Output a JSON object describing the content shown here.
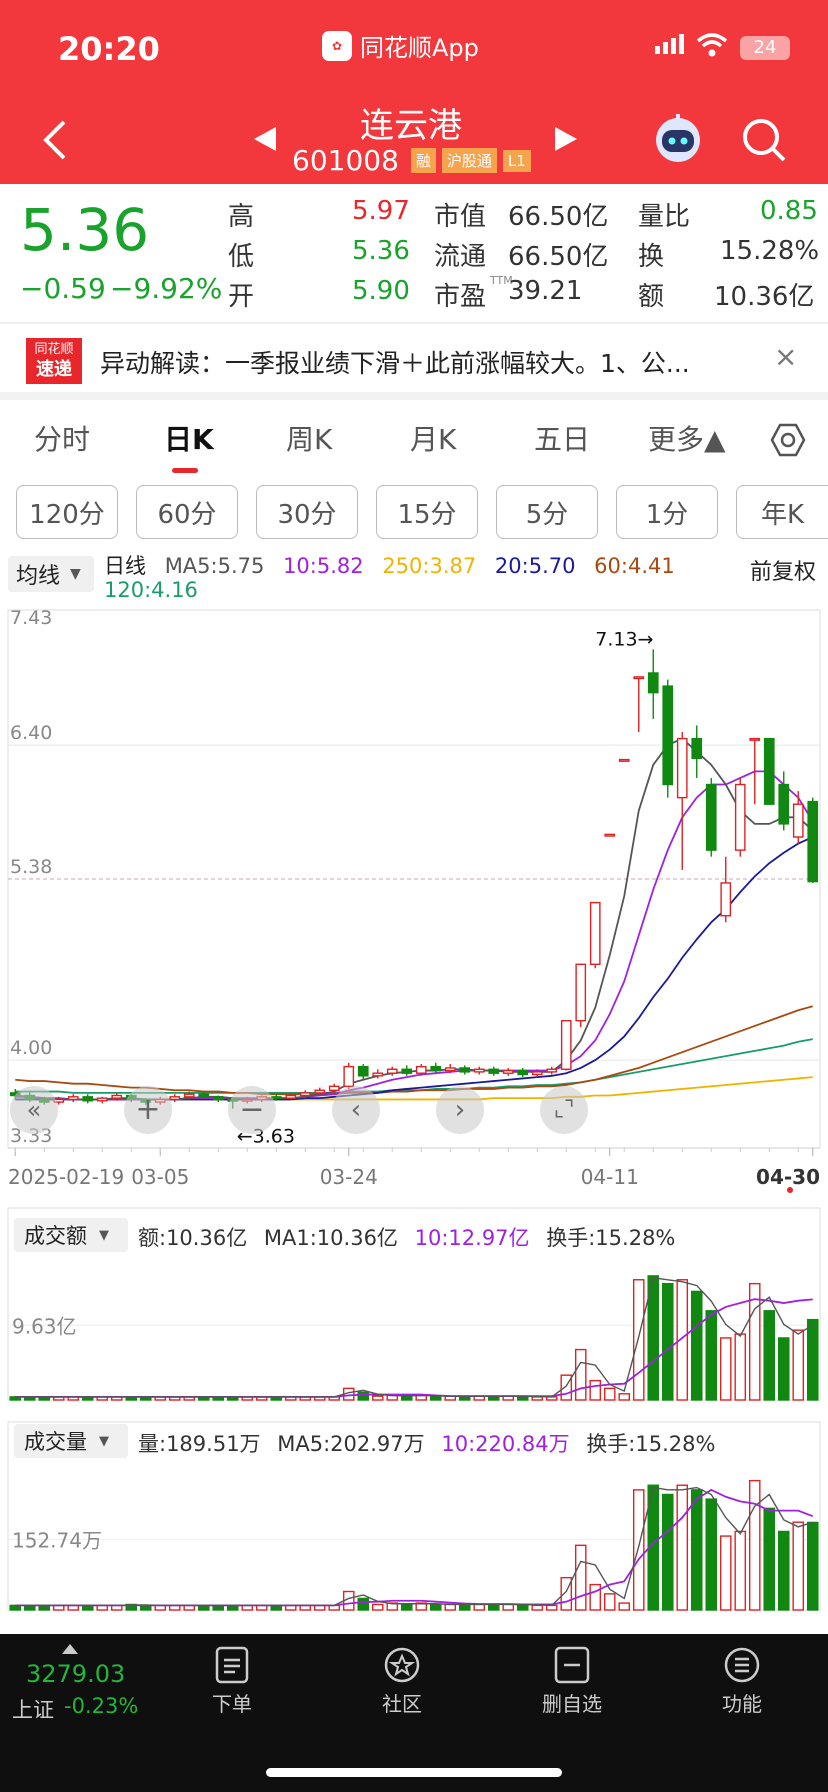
{
  "status": {
    "time": "20:20",
    "app": "同花顺App",
    "battery": "24"
  },
  "header": {
    "name": "连云港",
    "code": "601008",
    "badges": [
      "融",
      "沪股通",
      "L1"
    ]
  },
  "quote": {
    "price": "5.36",
    "change": "−0.59",
    "pct": "−9.92%",
    "c1": [
      {
        "k": "高",
        "v": "5.97",
        "c": "red"
      },
      {
        "k": "低",
        "v": "5.36",
        "c": "green"
      },
      {
        "k": "开",
        "v": "5.90",
        "c": "green"
      }
    ],
    "c2": [
      {
        "k": "市值",
        "v": "66.50亿"
      },
      {
        "k": "流通",
        "v": "66.50亿"
      },
      {
        "k": "市盈",
        "v": "39.21",
        "sup": "TTM"
      }
    ],
    "c3": [
      {
        "k": "量比",
        "v": "0.85",
        "c": "green"
      },
      {
        "k": "换",
        "v": "15.28%"
      },
      {
        "k": "额",
        "v": "10.36亿"
      }
    ]
  },
  "news": {
    "logo1": "同花顺",
    "logo2": "速递",
    "text": "异动解读：一季报业绩下滑＋此前涨幅较大。1、公..."
  },
  "tabs": [
    "分时",
    "日K",
    "周K",
    "月K",
    "五日",
    "更多▲"
  ],
  "periods": [
    "120分",
    "60分",
    "30分",
    "15分",
    "5分",
    "1分",
    "年K"
  ],
  "indicator": {
    "sel": "均线",
    "line": "日线",
    "ma5": "MA5:5.75",
    "ma10": "10:5.82",
    "ma250": "250:3.87",
    "ma20": "20:5.70",
    "ma60": "60:4.41",
    "ma120": "120:4.16",
    "fq": "前复权"
  },
  "chart_data": {
    "type": "candlestick",
    "title": "日线",
    "yticks": [
      "7.43",
      "6.40",
      "5.38",
      "4.00",
      "3.33"
    ],
    "xlabels": [
      "2025-02-19",
      "03-05",
      "03-24",
      "04-11",
      "04-30"
    ],
    "high_mark": "7.13→",
    "low_mark": "←3.63",
    "candles": [
      [
        3.75,
        3.73,
        3.78,
        3.7
      ],
      [
        3.73,
        3.7,
        3.76,
        3.68
      ],
      [
        3.7,
        3.68,
        3.72,
        3.66
      ],
      [
        3.68,
        3.7,
        3.72,
        3.66
      ],
      [
        3.7,
        3.72,
        3.74,
        3.68
      ],
      [
        3.72,
        3.69,
        3.74,
        3.67
      ],
      [
        3.69,
        3.71,
        3.72,
        3.67
      ],
      [
        3.71,
        3.73,
        3.75,
        3.69
      ],
      [
        3.73,
        3.7,
        3.74,
        3.68
      ],
      [
        3.7,
        3.68,
        3.71,
        3.66
      ],
      [
        3.68,
        3.7,
        3.72,
        3.66
      ],
      [
        3.7,
        3.72,
        3.74,
        3.68
      ],
      [
        3.72,
        3.74,
        3.76,
        3.7
      ],
      [
        3.74,
        3.72,
        3.76,
        3.7
      ],
      [
        3.72,
        3.7,
        3.73,
        3.68
      ],
      [
        3.7,
        3.69,
        3.71,
        3.63
      ],
      [
        3.69,
        3.7,
        3.72,
        3.67
      ],
      [
        3.7,
        3.72,
        3.73,
        3.68
      ],
      [
        3.72,
        3.71,
        3.74,
        3.69
      ],
      [
        3.71,
        3.73,
        3.75,
        3.7
      ],
      [
        3.73,
        3.75,
        3.77,
        3.71
      ],
      [
        3.75,
        3.77,
        3.79,
        3.73
      ],
      [
        3.77,
        3.8,
        3.82,
        3.75
      ],
      [
        3.8,
        3.95,
        3.98,
        3.78
      ],
      [
        3.95,
        3.88,
        3.97,
        3.85
      ],
      [
        3.88,
        3.9,
        3.93,
        3.86
      ],
      [
        3.9,
        3.93,
        3.95,
        3.88
      ],
      [
        3.93,
        3.9,
        3.96,
        3.88
      ],
      [
        3.9,
        3.95,
        3.97,
        3.88
      ],
      [
        3.95,
        3.92,
        3.98,
        3.9
      ],
      [
        3.92,
        3.94,
        3.97,
        3.9
      ],
      [
        3.94,
        3.91,
        3.96,
        3.89
      ],
      [
        3.91,
        3.93,
        3.95,
        3.89
      ],
      [
        3.93,
        3.9,
        3.95,
        3.88
      ],
      [
        3.9,
        3.92,
        3.94,
        3.88
      ],
      [
        3.92,
        3.89,
        3.94,
        3.87
      ],
      [
        3.89,
        3.91,
        3.93,
        3.87
      ],
      [
        3.91,
        3.93,
        3.95,
        3.89
      ],
      [
        3.93,
        4.3,
        4.3,
        3.92
      ],
      [
        4.3,
        4.73,
        4.73,
        4.25
      ],
      [
        4.73,
        5.2,
        5.2,
        4.7
      ],
      [
        5.72,
        5.72,
        5.72,
        5.72
      ],
      [
        6.29,
        6.29,
        6.29,
        6.29
      ],
      [
        6.92,
        6.92,
        6.92,
        6.5
      ],
      [
        6.95,
        6.8,
        7.13,
        6.6
      ],
      [
        6.85,
        6.1,
        6.9,
        6.0
      ],
      [
        6.0,
        6.45,
        6.5,
        5.45
      ],
      [
        6.45,
        6.3,
        6.55,
        6.15
      ],
      [
        6.1,
        5.6,
        6.15,
        5.55
      ],
      [
        5.1,
        5.35,
        5.55,
        5.05
      ],
      [
        5.6,
        6.1,
        6.15,
        5.55
      ],
      [
        6.45,
        6.45,
        6.45,
        5.95
      ],
      [
        6.45,
        5.95,
        6.45,
        5.95
      ],
      [
        6.1,
        5.8,
        6.2,
        5.75
      ],
      [
        5.7,
        5.95,
        6.05,
        5.65
      ],
      [
        5.97,
        5.36,
        6.0,
        5.35
      ]
    ],
    "ma5": [
      3.73,
      3.72,
      3.71,
      3.7,
      3.7,
      3.7,
      3.7,
      3.71,
      3.71,
      3.7,
      3.7,
      3.7,
      3.71,
      3.72,
      3.72,
      3.71,
      3.7,
      3.7,
      3.71,
      3.71,
      3.72,
      3.74,
      3.76,
      3.82,
      3.85,
      3.88,
      3.9,
      3.91,
      3.92,
      3.92,
      3.93,
      3.93,
      3.92,
      3.92,
      3.91,
      3.91,
      3.91,
      3.91,
      4.0,
      4.15,
      4.4,
      4.8,
      5.25,
      5.9,
      6.25,
      6.4,
      6.45,
      6.35,
      6.25,
      6.1,
      5.9,
      5.8,
      5.8,
      5.85,
      5.85,
      5.75
    ],
    "ma10": [
      3.72,
      3.72,
      3.71,
      3.71,
      3.7,
      3.7,
      3.7,
      3.7,
      3.7,
      3.7,
      3.7,
      3.7,
      3.71,
      3.71,
      3.71,
      3.71,
      3.71,
      3.71,
      3.71,
      3.71,
      3.72,
      3.73,
      3.74,
      3.77,
      3.79,
      3.82,
      3.85,
      3.87,
      3.89,
      3.9,
      3.91,
      3.92,
      3.92,
      3.92,
      3.92,
      3.92,
      3.92,
      3.92,
      3.96,
      4.03,
      4.15,
      4.35,
      4.6,
      4.95,
      5.3,
      5.6,
      5.85,
      6.0,
      6.1,
      6.1,
      6.15,
      6.2,
      6.2,
      6.1,
      6.0,
      5.82
    ],
    "ma20": [
      3.7,
      3.7,
      3.7,
      3.7,
      3.7,
      3.7,
      3.7,
      3.7,
      3.7,
      3.7,
      3.7,
      3.7,
      3.7,
      3.7,
      3.7,
      3.7,
      3.7,
      3.7,
      3.7,
      3.7,
      3.71,
      3.71,
      3.72,
      3.73,
      3.74,
      3.75,
      3.77,
      3.78,
      3.79,
      3.8,
      3.81,
      3.82,
      3.83,
      3.84,
      3.85,
      3.86,
      3.87,
      3.88,
      3.9,
      3.94,
      4.0,
      4.08,
      4.18,
      4.32,
      4.48,
      4.62,
      4.78,
      4.92,
      5.05,
      5.15,
      5.28,
      5.4,
      5.5,
      5.58,
      5.65,
      5.7
    ],
    "ma60": [
      3.85,
      3.84,
      3.84,
      3.83,
      3.82,
      3.82,
      3.81,
      3.8,
      3.79,
      3.79,
      3.78,
      3.77,
      3.77,
      3.76,
      3.76,
      3.75,
      3.75,
      3.74,
      3.74,
      3.74,
      3.74,
      3.74,
      3.74,
      3.75,
      3.75,
      3.75,
      3.76,
      3.76,
      3.77,
      3.77,
      3.77,
      3.78,
      3.78,
      3.78,
      3.79,
      3.79,
      3.8,
      3.8,
      3.81,
      3.83,
      3.85,
      3.88,
      3.91,
      3.94,
      3.98,
      4.02,
      4.06,
      4.1,
      4.14,
      4.18,
      4.22,
      4.26,
      4.3,
      4.34,
      4.38,
      4.41
    ],
    "ma120": [
      3.76,
      3.76,
      3.76,
      3.76,
      3.75,
      3.75,
      3.75,
      3.75,
      3.75,
      3.75,
      3.75,
      3.75,
      3.75,
      3.75,
      3.75,
      3.75,
      3.75,
      3.75,
      3.75,
      3.75,
      3.75,
      3.75,
      3.75,
      3.76,
      3.76,
      3.76,
      3.77,
      3.77,
      3.77,
      3.78,
      3.78,
      3.78,
      3.79,
      3.79,
      3.8,
      3.8,
      3.81,
      3.81,
      3.82,
      3.83,
      3.85,
      3.87,
      3.89,
      3.91,
      3.93,
      3.95,
      3.97,
      3.99,
      4.01,
      4.03,
      4.05,
      4.07,
      4.09,
      4.11,
      4.14,
      4.16
    ],
    "ma250": [
      3.7,
      3.7,
      3.7,
      3.7,
      3.7,
      3.7,
      3.7,
      3.7,
      3.7,
      3.7,
      3.7,
      3.7,
      3.7,
      3.7,
      3.7,
      3.7,
      3.7,
      3.7,
      3.7,
      3.7,
      3.7,
      3.7,
      3.7,
      3.7,
      3.7,
      3.7,
      3.7,
      3.7,
      3.7,
      3.7,
      3.7,
      3.7,
      3.7,
      3.71,
      3.71,
      3.71,
      3.71,
      3.71,
      3.72,
      3.72,
      3.73,
      3.73,
      3.74,
      3.75,
      3.76,
      3.77,
      3.78,
      3.79,
      3.8,
      3.81,
      3.82,
      3.83,
      3.84,
      3.85,
      3.86,
      3.87
    ]
  },
  "turnover": {
    "sel": "成交额",
    "v": "额:10.36亿",
    "ma1": "MA1:10.36亿",
    "ma10": "10:12.97亿",
    "hs": "换手:15.28%",
    "ytick": "9.63亿",
    "values": [
      0.4,
      0.4,
      0.4,
      0.4,
      0.4,
      0.4,
      0.4,
      0.4,
      0.4,
      0.4,
      0.4,
      0.4,
      0.4,
      0.4,
      0.4,
      0.4,
      0.4,
      0.4,
      0.4,
      0.4,
      0.4,
      0.4,
      0.4,
      1.5,
      1.0,
      0.5,
      0.6,
      0.5,
      0.6,
      0.5,
      0.5,
      0.5,
      0.5,
      0.5,
      0.5,
      0.5,
      0.4,
      0.4,
      3.2,
      6.5,
      2.5,
      1.5,
      0.8,
      15.5,
      16.0,
      15.0,
      15.5,
      14.0,
      11.5,
      8.0,
      8.5,
      15.0,
      11.5,
      8.0,
      9.0,
      10.36
    ],
    "ma": [
      0.4,
      0.4,
      0.4,
      0.4,
      0.4,
      0.4,
      0.4,
      0.4,
      0.4,
      0.4,
      0.4,
      0.4,
      0.4,
      0.4,
      0.4,
      0.4,
      0.4,
      0.4,
      0.4,
      0.4,
      0.4,
      0.4,
      0.4,
      0.6,
      0.7,
      0.7,
      0.7,
      0.7,
      0.7,
      0.6,
      0.5,
      0.5,
      0.5,
      0.5,
      0.5,
      0.5,
      0.5,
      0.5,
      0.8,
      1.5,
      1.8,
      2.0,
      2.1,
      3.5,
      5.0,
      6.5,
      8.0,
      9.5,
      11.0,
      12.0,
      12.5,
      13.0,
      12.8,
      12.5,
      12.8,
      12.97
    ]
  },
  "volume": {
    "sel": "成交量",
    "v": "量:189.51万",
    "ma5": "MA5:202.97万",
    "ma10": "10:220.84万",
    "hs": "换手:15.28%",
    "ytick": "152.74万",
    "values": [
      10,
      10,
      10,
      10,
      10,
      10,
      10,
      10,
      12,
      10,
      10,
      10,
      10,
      10,
      10,
      10,
      10,
      10,
      10,
      10,
      10,
      10,
      10,
      40,
      25,
      12,
      15,
      12,
      15,
      12,
      12,
      12,
      12,
      12,
      12,
      12,
      10,
      10,
      70,
      140,
      55,
      35,
      15,
      260,
      270,
      250,
      270,
      260,
      240,
      160,
      170,
      280,
      220,
      170,
      190,
      189.51
    ],
    "ma": [
      10,
      10,
      10,
      10,
      10,
      10,
      10,
      10,
      10,
      10,
      10,
      10,
      10,
      10,
      10,
      10,
      10,
      10,
      10,
      10,
      10,
      10,
      10,
      14,
      17,
      18,
      20,
      20,
      20,
      18,
      16,
      14,
      13,
      13,
      13,
      12,
      12,
      12,
      18,
      30,
      40,
      55,
      62,
      110,
      145,
      170,
      200,
      240,
      260,
      245,
      235,
      230,
      215,
      215,
      215,
      202.97
    ]
  },
  "bottom": {
    "index": "3279.03",
    "index_name": "上证",
    "index_pct": "-0.23%",
    "nav": [
      "下单",
      "社区",
      "删自选",
      "功能"
    ]
  }
}
